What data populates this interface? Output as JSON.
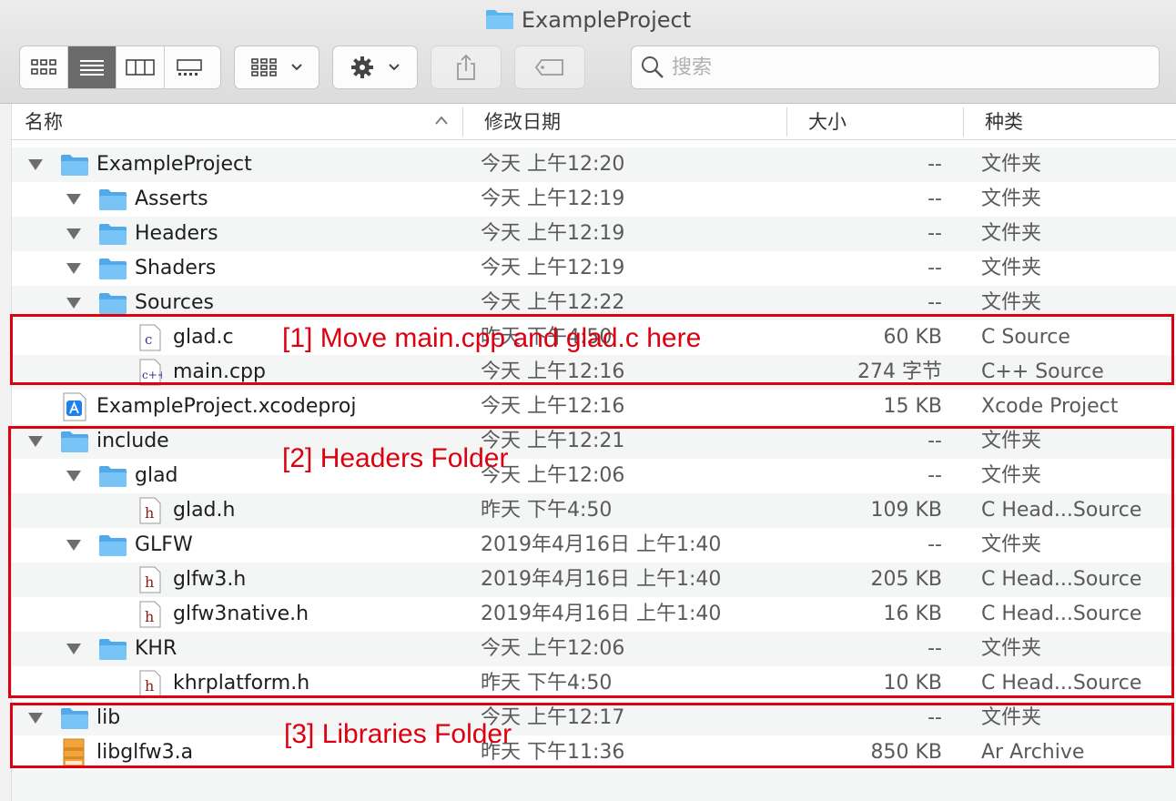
{
  "window": {
    "title": "ExampleProject"
  },
  "toolbar": {
    "view_modes": [
      "icon-view",
      "list-view",
      "column-view",
      "gallery-view"
    ],
    "active_view": "list-view",
    "search_placeholder": "搜索"
  },
  "columns": {
    "name": "名称",
    "date": "修改日期",
    "size": "大小",
    "kind": "种类"
  },
  "rows": [
    {
      "name": "ExampleProject",
      "date": "今天 上午12:20",
      "size": "--",
      "kind": "文件夹",
      "icon": "folder-icon",
      "depth": 0,
      "expanded": true
    },
    {
      "name": "Asserts",
      "date": "今天 上午12:19",
      "size": "--",
      "kind": "文件夹",
      "icon": "folder-icon",
      "depth": 1,
      "expanded": true
    },
    {
      "name": "Headers",
      "date": "今天 上午12:19",
      "size": "--",
      "kind": "文件夹",
      "icon": "folder-icon",
      "depth": 1,
      "expanded": true
    },
    {
      "name": "Shaders",
      "date": "今天 上午12:19",
      "size": "--",
      "kind": "文件夹",
      "icon": "folder-icon",
      "depth": 1,
      "expanded": true
    },
    {
      "name": "Sources",
      "date": "今天 上午12:22",
      "size": "--",
      "kind": "文件夹",
      "icon": "folder-icon",
      "depth": 1,
      "expanded": true
    },
    {
      "name": "glad.c",
      "date": "昨天 下午4:50",
      "size": "60 KB",
      "kind": "C Source",
      "icon": "c-source-file-icon",
      "depth": 2
    },
    {
      "name": "main.cpp",
      "date": "今天 上午12:16",
      "size": "274 字节",
      "kind": "C++ Source",
      "icon": "cpp-source-file-icon",
      "depth": 2
    },
    {
      "name": "ExampleProject.xcodeproj",
      "date": "今天 上午12:16",
      "size": "15 KB",
      "kind": "Xcode Project",
      "icon": "xcode-project-icon",
      "depth": 0
    },
    {
      "name": "include",
      "date": "今天 上午12:21",
      "size": "--",
      "kind": "文件夹",
      "icon": "folder-icon",
      "depth": 0,
      "expanded": true
    },
    {
      "name": "glad",
      "date": "今天 上午12:06",
      "size": "--",
      "kind": "文件夹",
      "icon": "folder-icon",
      "depth": 1,
      "expanded": true
    },
    {
      "name": "glad.h",
      "date": "昨天 下午4:50",
      "size": "109 KB",
      "kind": "C Head...Source",
      "icon": "header-file-icon",
      "depth": 2
    },
    {
      "name": "GLFW",
      "date": "2019年4月16日 上午1:40",
      "size": "--",
      "kind": "文件夹",
      "icon": "folder-icon",
      "depth": 1,
      "expanded": true
    },
    {
      "name": "glfw3.h",
      "date": "2019年4月16日 上午1:40",
      "size": "205 KB",
      "kind": "C Head...Source",
      "icon": "header-file-icon",
      "depth": 2
    },
    {
      "name": "glfw3native.h",
      "date": "2019年4月16日 上午1:40",
      "size": "16 KB",
      "kind": "C Head...Source",
      "icon": "header-file-icon",
      "depth": 2
    },
    {
      "name": "KHR",
      "date": "今天 上午12:06",
      "size": "--",
      "kind": "文件夹",
      "icon": "folder-icon",
      "depth": 1,
      "expanded": true
    },
    {
      "name": "khrplatform.h",
      "date": "昨天 下午4:50",
      "size": "10 KB",
      "kind": "C Head...Source",
      "icon": "header-file-icon",
      "depth": 2
    },
    {
      "name": "lib",
      "date": "今天 上午12:17",
      "size": "--",
      "kind": "文件夹",
      "icon": "folder-icon",
      "depth": 0,
      "expanded": true
    },
    {
      "name": "libglfw3.a",
      "date": "昨天 下午11:36",
      "size": "850 KB",
      "kind": "Ar Archive",
      "icon": "archive-file-icon",
      "depth": 1
    }
  ],
  "annotations": [
    {
      "label": "[1] Move main.cpp and glad.c here"
    },
    {
      "label": "[2] Headers Folder"
    },
    {
      "label": "[3] Libraries Folder"
    }
  ],
  "colors": {
    "annotation": "#dd0011",
    "folder": "#5ab4f0",
    "active_segment": "#6b6b6b"
  }
}
